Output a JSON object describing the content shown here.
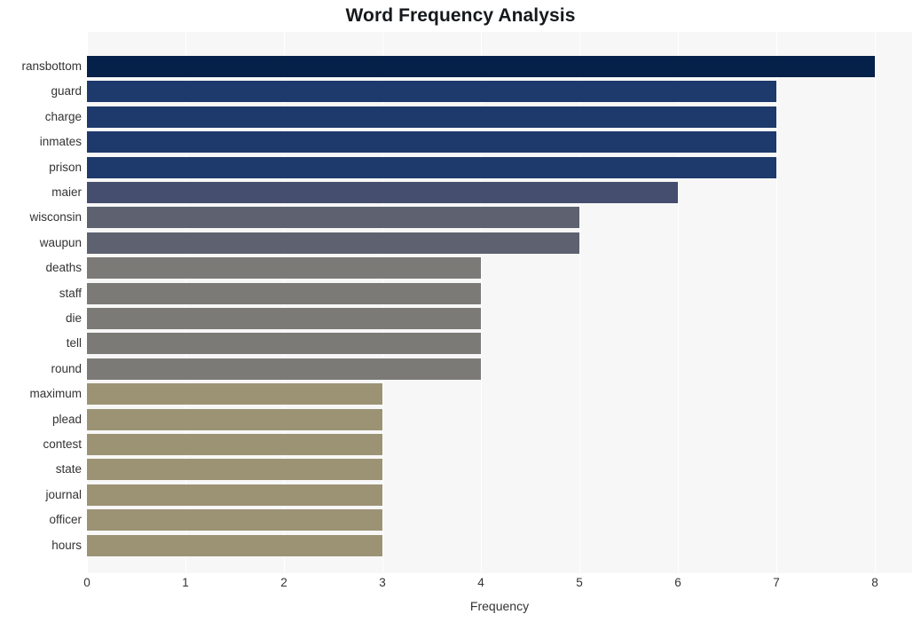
{
  "chart_data": {
    "type": "bar",
    "orientation": "horizontal",
    "title": "Word Frequency Analysis",
    "xlabel": "Frequency",
    "ylabel": "",
    "xlim": [
      0,
      8
    ],
    "xticks": [
      "0",
      "1",
      "2",
      "3",
      "4",
      "5",
      "6",
      "7",
      "8"
    ],
    "grid": true,
    "grid_axis": "x",
    "legend": "none",
    "categories": [
      "ransbottom",
      "guard",
      "charge",
      "inmates",
      "prison",
      "maier",
      "wisconsin",
      "waupun",
      "deaths",
      "staff",
      "die",
      "tell",
      "round",
      "maximum",
      "plead",
      "contest",
      "state",
      "journal",
      "officer",
      "hours"
    ],
    "values": [
      8,
      7,
      7,
      7,
      7,
      6,
      5,
      5,
      4,
      4,
      4,
      4,
      4,
      3,
      3,
      3,
      3,
      3,
      3,
      3
    ],
    "bar_colors": [
      "#05214a",
      "#1e3a6d",
      "#1e3a6d",
      "#1e3a6d",
      "#1e3a6d",
      "#454e6e",
      "#5e6270",
      "#5e6270",
      "#7b7a76",
      "#7b7a76",
      "#7b7a76",
      "#7b7a76",
      "#7b7a76",
      "#9c9375",
      "#9c9375",
      "#9c9375",
      "#9c9375",
      "#9c9375",
      "#9c9375",
      "#9c9375"
    ]
  },
  "style": {
    "plot_background": "#f7f7f7",
    "gridline_color": "#ffffff",
    "figure_background": "#ffffff",
    "text_color": "#333333",
    "title_color": "#16191c"
  }
}
